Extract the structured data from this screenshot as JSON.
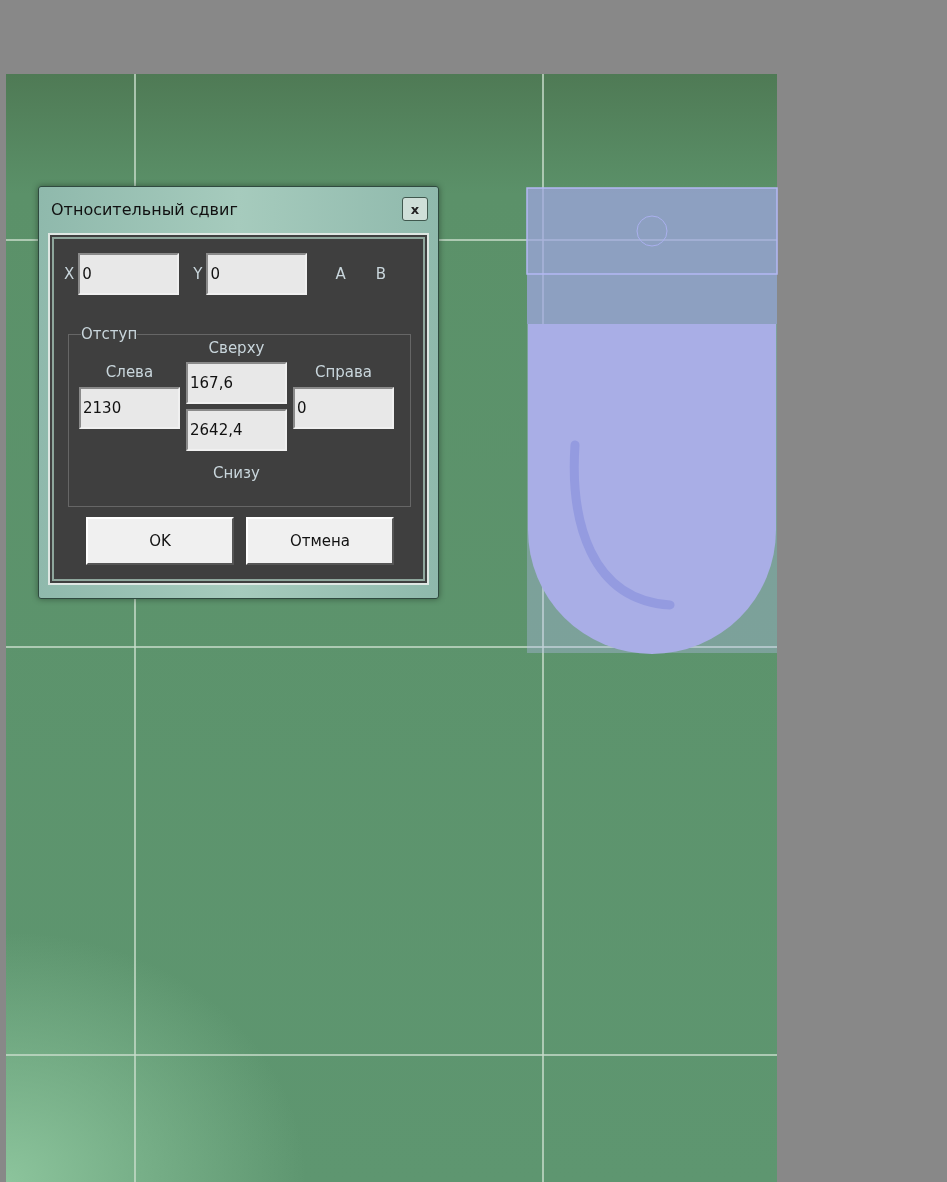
{
  "dialog": {
    "title": "Относительный сдвиг",
    "close": "x",
    "x_label": "X",
    "x_value": "0",
    "y_label": "Y",
    "y_value": "0",
    "a_label": "A",
    "b_label": "B",
    "offset_group": {
      "title": "Отступ",
      "top_label": "Сверху",
      "top_value": "167,6",
      "left_label": "Слева",
      "left_value": "2130",
      "right_label": "Справа",
      "right_value": "0",
      "bottom_value": "2642,4",
      "bottom_label": "Снизу"
    },
    "buttons": [
      "OK",
      "Отмена"
    ]
  }
}
